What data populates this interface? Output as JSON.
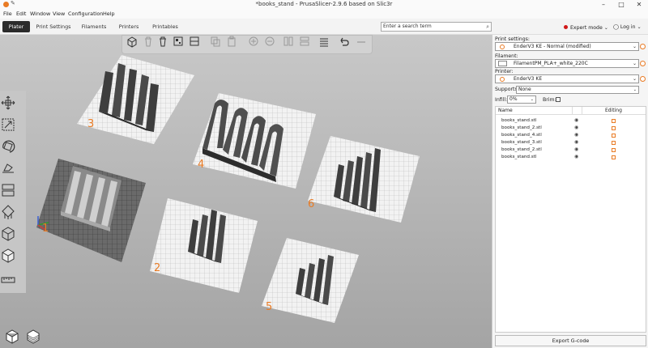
{
  "window": {
    "title": "*books_stand - PrusaSlicer-2.9.6 based on Slic3r"
  },
  "menu": [
    "File",
    "Edit",
    "Window",
    "View",
    "Configuration",
    "Help"
  ],
  "tabs": [
    "Plater",
    "Print Settings",
    "Filaments",
    "Printers",
    "Printables"
  ],
  "search": {
    "placeholder": "Enter a search term"
  },
  "mode": "Expert mode",
  "login": "Log in",
  "plater_labels": [
    "1",
    "2",
    "3",
    "4",
    "5",
    "6"
  ],
  "sidebar": {
    "print_settings_label": "Print settings:",
    "print_settings_value": "EnderV3 KE - Normal (modified)",
    "filament_label": "Filament:",
    "filament_value": "FilamentPM_PLA+_white_220C",
    "printer_label": "Printer:",
    "printer_value": "EnderV3 KE",
    "supports_label": "Supports:",
    "supports_value": "None",
    "infill_label": "Infill:",
    "infill_value": "0%",
    "brim_label": "Brim:",
    "list_header_name": "Name",
    "list_header_editing": "Editing",
    "objects": [
      "books_stand.stl",
      "books_stand_2.stl",
      "books_stand_4.stl",
      "books_stand_3.stl",
      "books_stand_2.stl",
      "books_stand.stl"
    ],
    "export_label": "Export G-code"
  },
  "colors": {
    "accent": "#e97b24",
    "active_tab": "#2b2b2b",
    "expert_dot": "#d01818"
  }
}
